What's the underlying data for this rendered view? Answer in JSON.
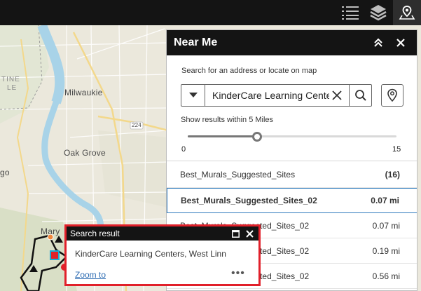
{
  "toolbar": {
    "buttons": [
      {
        "icon": "list-icon"
      },
      {
        "icon": "layers-icon"
      },
      {
        "icon": "near-me-icon"
      }
    ]
  },
  "map": {
    "labels": [
      "TINE",
      "LE",
      "Milwaukie",
      "Oak Grove",
      "224",
      "go",
      "Mary"
    ]
  },
  "near_me": {
    "title": "Near Me",
    "search_hint": "Search for an address or locate on map",
    "search_value": "KinderCare Learning Centers, West Linn",
    "radius_label": "Show results within 5 Miles",
    "slider": {
      "min": "0",
      "max": "15",
      "value": 5,
      "min_value": 0,
      "max_value": 15
    },
    "layer": {
      "name": "Best_Murals_Suggested_Sites",
      "count": "(16)"
    },
    "results": [
      {
        "name": "Best_Murals_Suggested_Sites_02",
        "distance": "0.07 mi",
        "selected": true
      },
      {
        "name": "Best_Murals_Suggested_Sites_02",
        "distance": "0.07 mi",
        "selected": false
      },
      {
        "name": "Best_Murals_Suggested_Sites_02",
        "distance": "0.19 mi",
        "selected": false
      },
      {
        "name": "Best_Murals_Suggested_Sites_02",
        "distance": "0.56 mi",
        "selected": false
      }
    ]
  },
  "popup": {
    "title": "Search result",
    "text": "KinderCare Learning Centers, West Linn",
    "zoom_label": "Zoom to",
    "more_label": "•••"
  },
  "colors": {
    "highlight": "#e1202a",
    "selection": "#2f7bbd",
    "link": "#2f6db3",
    "river": "#a8d3e8"
  }
}
